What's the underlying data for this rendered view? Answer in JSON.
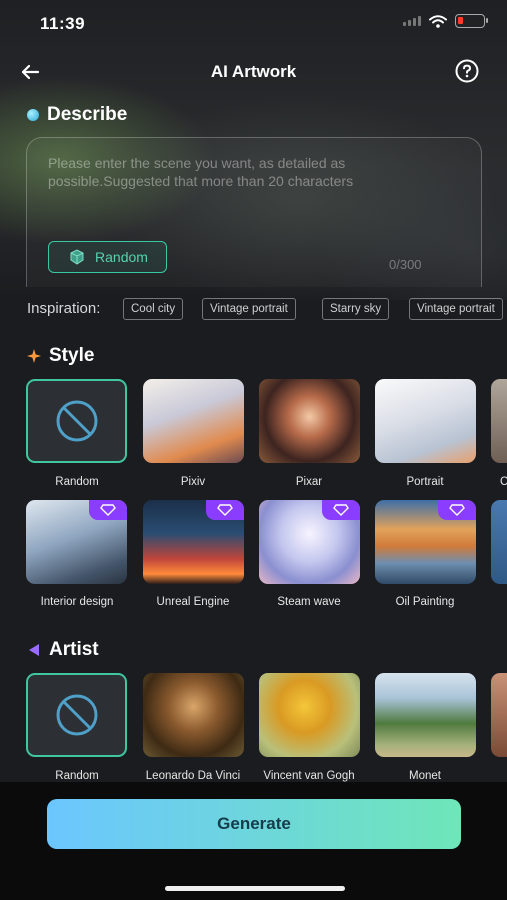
{
  "status": {
    "time": "11:39",
    "battery_level": 0.2
  },
  "nav": {
    "title": "AI Artwork"
  },
  "describe": {
    "title": "Describe",
    "placeholder": "Please enter the scene you want, as detailed as possible.Suggested that more than 20 characters",
    "random_label": "Random",
    "counter": "0/300"
  },
  "inspiration": {
    "label": "Inspiration:",
    "chips": [
      "Cool city",
      "Vintage portrait",
      "Starry sky",
      "Vintage portrait"
    ]
  },
  "style": {
    "title": "Style",
    "row1": [
      "Random",
      "Pixiv",
      "Pixar",
      "Portrait",
      "C"
    ],
    "row2": [
      "Interior design",
      "Unreal Engine",
      "Steam wave",
      "Oil Painting"
    ]
  },
  "artist": {
    "title": "Artist",
    "items": [
      "Random",
      "Leonardo Da Vinci",
      "Vincent van Gogh",
      "Monet"
    ]
  },
  "generate_label": "Generate",
  "colors": {
    "accent_teal": "#3ec7a1",
    "vip_purple": "#8b3dff",
    "generate_start": "#6cc6ff",
    "generate_end": "#6ee6b8"
  }
}
